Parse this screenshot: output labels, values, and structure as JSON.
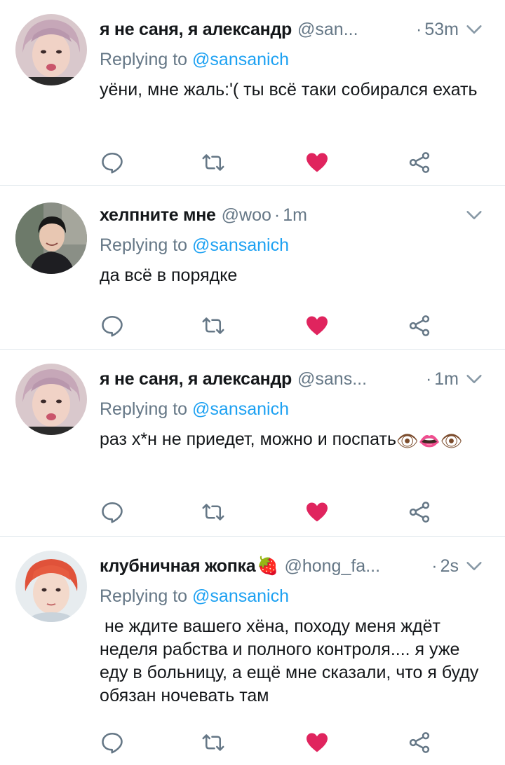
{
  "tweets": [
    {
      "name": "я не саня, я александр",
      "handle": "@san...",
      "separator": "·",
      "time": "53m",
      "replying_prefix": "Replying to ",
      "replying_mention": "@sansanich",
      "text": "уёни, мне жаль:'( ты всё таки собирался ехать",
      "avatar": "avatar-pink-hair"
    },
    {
      "name": "хелпните мне",
      "handle": "@woo",
      "separator": "·",
      "time": "1m",
      "replying_prefix": "Replying to ",
      "replying_mention": "@sansanich",
      "text": "да всё в порядке",
      "avatar": "avatar-dark-hair-hoodie"
    },
    {
      "name": "я не саня, я александр",
      "handle": "@sans...",
      "separator": "·",
      "time": "1m",
      "replying_prefix": "Replying to ",
      "replying_mention": "@sansanich",
      "text": "раз х*н не приедет, можно и поспать",
      "emoji": "👁👄👁",
      "avatar": "avatar-pink-hair"
    },
    {
      "name": "клубничная жопка",
      "name_emoji": "🍓",
      "handle": "@hong_fa...",
      "separator": "·",
      "time": "2s",
      "replying_prefix": "Replying to ",
      "replying_mention": "@sansanich",
      "text": " не ждите вашего хёна, походу меня ждёт неделя рабства и полного контроля.... я уже еду в больницу, а ещё мне сказали, что я буду обязан ночевать там",
      "avatar": "avatar-red-hair"
    }
  ],
  "icons": {
    "reply": "reply-icon",
    "retweet": "retweet-icon",
    "like": "heart-icon",
    "share": "share-icon",
    "menu": "chevron-down-icon"
  },
  "colors": {
    "secondary_text": "#657786",
    "mention": "#1da1f2",
    "like_active": "#e0245e",
    "divider": "#e1e8ed"
  }
}
